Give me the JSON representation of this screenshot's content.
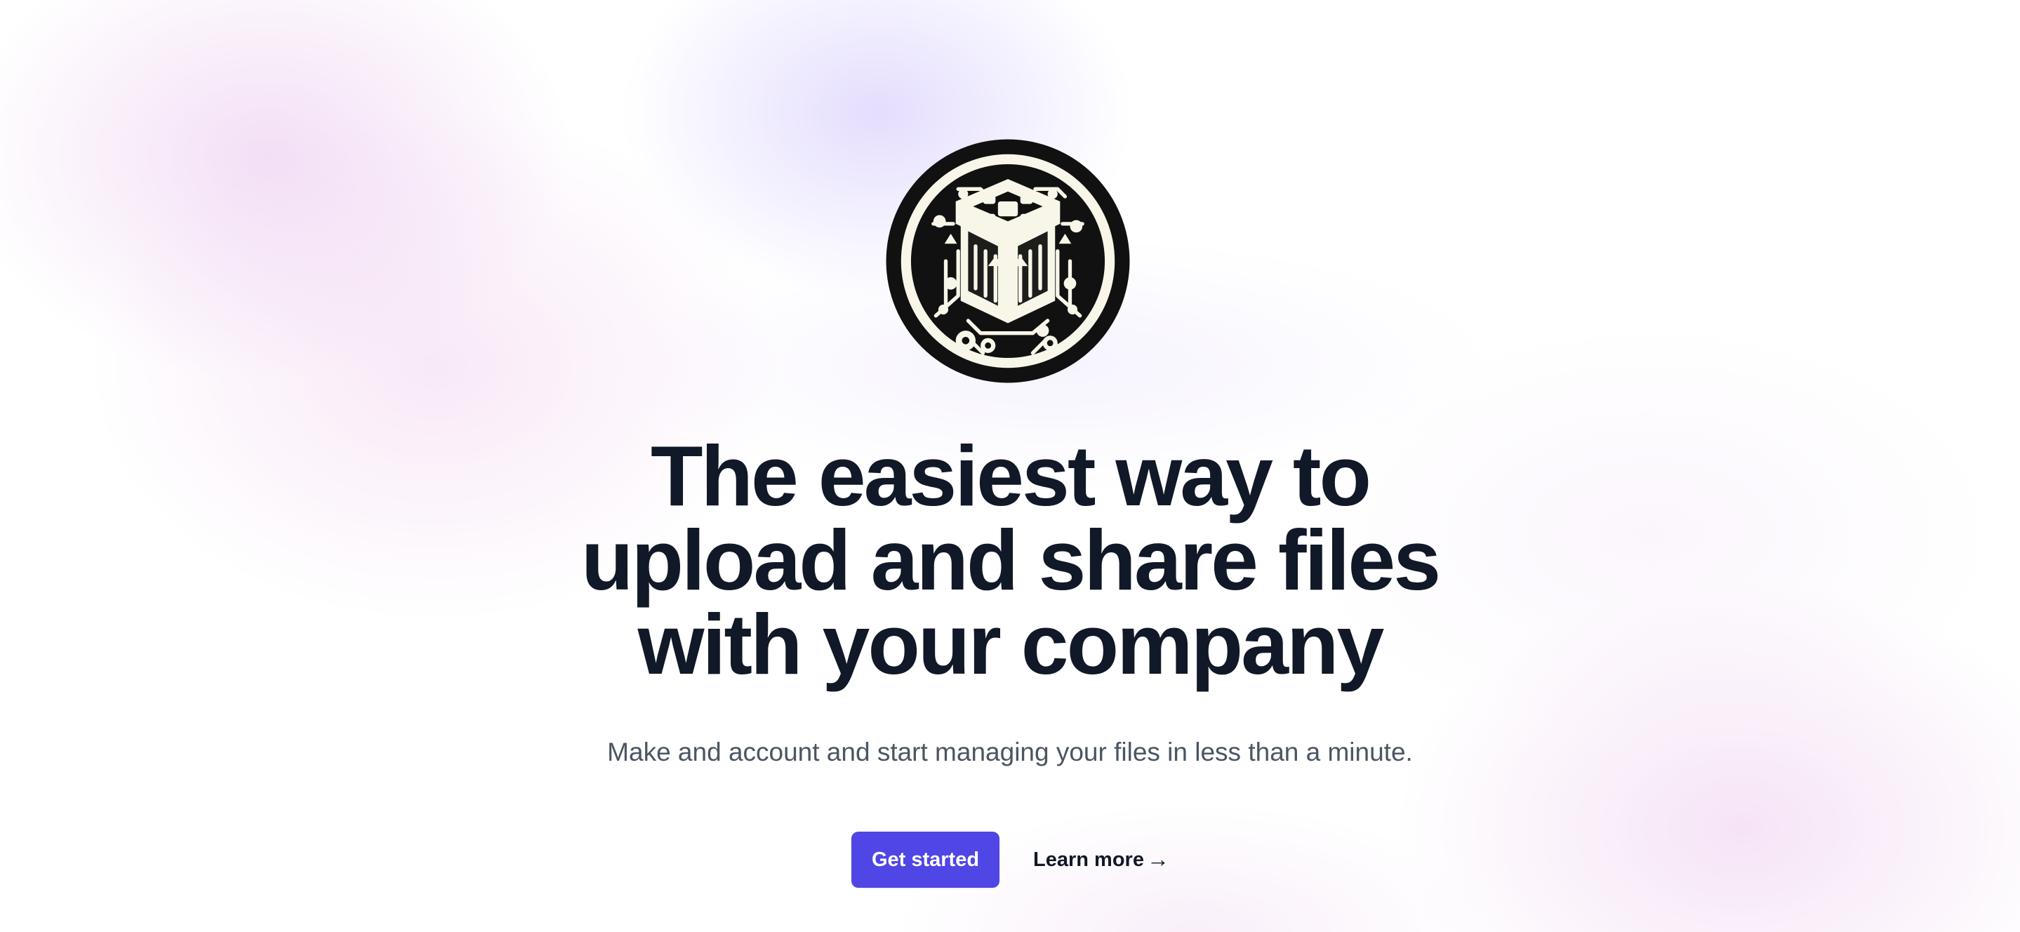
{
  "hero": {
    "logo_icon": "circuit-file-box-logo-icon",
    "title_lines": [
      "The easiest way to",
      "upload and share files",
      "with your company"
    ],
    "subtitle": "Make and account and start managing your files in less than a minute.",
    "primary_action_label": "Get started",
    "secondary_action_label": "Learn more",
    "secondary_action_arrow": "→"
  },
  "colors": {
    "text": "#111827",
    "muted_text": "#4b5563",
    "primary_button": "#4f46e5",
    "primary_button_text": "#ffffff",
    "background": "#ffffff",
    "gradient_lilac": "#c4b5fd",
    "gradient_pink": "#e9c4ee"
  }
}
